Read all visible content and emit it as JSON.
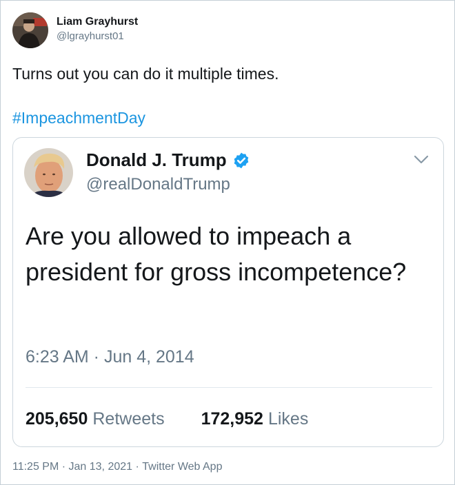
{
  "tweet": {
    "author_name": "Liam Grayhurst",
    "author_handle": "@lgrayhurst01",
    "text": "Turns out you can do it multiple times.",
    "hashtag": "#ImpeachmentDay",
    "timestamp": "11:25 PM · Jan 13, 2021 · ",
    "source": "Twitter Web App"
  },
  "quoted_tweet": {
    "author_name": "Donald J. Trump",
    "author_handle": "@realDonaldTrump",
    "verified_icon": "verified-badge-icon",
    "text": "Are you allowed to impeach a president for gross incompetence?",
    "timestamp": "6:23 AM · Jun 4, 2014",
    "retweets_count": "205,650",
    "retweets_label": "Retweets",
    "likes_count": "172,952",
    "likes_label": "Likes",
    "menu_icon": "chevron-down-icon"
  },
  "colors": {
    "link": "#1b95e0",
    "secondary_text": "#657786",
    "primary_text": "#14171a",
    "verified": "#1da1f2",
    "border": "#ccd6dd"
  }
}
